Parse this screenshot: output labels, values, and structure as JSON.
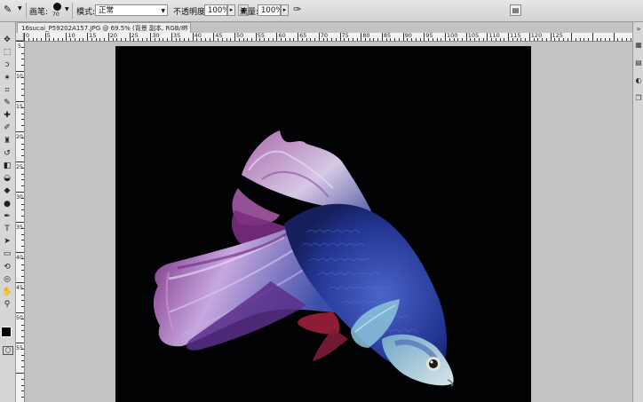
{
  "options_bar": {
    "brush_label": "画笔:",
    "brush_size": "70",
    "mode_label": "模式:",
    "mode_value": "正常",
    "opacity_label": "不透明度:",
    "opacity_value": "100%",
    "flow_label": "流量:",
    "flow_value": "100%"
  },
  "document": {
    "tab_title": "16sucai_P59202A157.JPG @ 69.5% (背景 副本, RGB/8) *",
    "close_glyph": "×"
  },
  "rulers": {
    "horizontal_labels": [
      "0",
      "5",
      "10",
      "15",
      "20",
      "25",
      "30",
      "35",
      "40",
      "45",
      "50",
      "55",
      "60",
      "65",
      "70",
      "75",
      "80",
      "85",
      "90",
      "95",
      "100",
      "105",
      "110",
      "115",
      "120",
      "125"
    ],
    "vertical_labels": [
      "5",
      "10",
      "15",
      "20",
      "25",
      "30",
      "35",
      "40",
      "45",
      "50",
      "55"
    ]
  },
  "tools": [
    {
      "name": "move-tool",
      "glyph": "✥"
    },
    {
      "name": "marquee-tool",
      "glyph": "⬚"
    },
    {
      "name": "lasso-tool",
      "glyph": "ↄ"
    },
    {
      "name": "magic-wand-tool",
      "glyph": "✶"
    },
    {
      "name": "crop-tool",
      "glyph": "⌗"
    },
    {
      "name": "eyedropper-tool",
      "glyph": "✎"
    },
    {
      "name": "healing-brush-tool",
      "glyph": "✚"
    },
    {
      "name": "brush-tool",
      "glyph": "✐"
    },
    {
      "name": "clone-stamp-tool",
      "glyph": "♜"
    },
    {
      "name": "history-brush-tool",
      "glyph": "↺"
    },
    {
      "name": "eraser-tool",
      "glyph": "◧"
    },
    {
      "name": "paint-bucket-tool",
      "glyph": "◒"
    },
    {
      "name": "blur-tool",
      "glyph": "◆"
    },
    {
      "name": "dodge-tool",
      "glyph": "●"
    },
    {
      "name": "pen-tool",
      "glyph": "✒"
    },
    {
      "name": "type-tool",
      "glyph": "T"
    },
    {
      "name": "path-selection-tool",
      "glyph": "➤"
    },
    {
      "name": "shape-tool",
      "glyph": "▭"
    },
    {
      "name": "3d-rotate-tool",
      "glyph": "⟲"
    },
    {
      "name": "3d-orbit-tool",
      "glyph": "◎"
    },
    {
      "name": "hand-tool",
      "glyph": "✋"
    },
    {
      "name": "zoom-tool",
      "glyph": "⚲"
    }
  ],
  "right_panel_icons": [
    {
      "name": "collapse-panels-icon",
      "glyph": "»"
    },
    {
      "name": "color-panel-icon",
      "glyph": "▦"
    },
    {
      "name": "swatches-panel-icon",
      "glyph": "▤"
    },
    {
      "name": "adjustments-panel-icon",
      "glyph": "◐"
    },
    {
      "name": "layers-panel-icon",
      "glyph": "❐"
    }
  ],
  "colors": {
    "canvas_background": "#020204",
    "workspace": "#c3c3c3",
    "fish_body": "#2a3f9a",
    "fin_magenta": "#9a3a8e",
    "fin_pale": "#c9b6e6"
  }
}
